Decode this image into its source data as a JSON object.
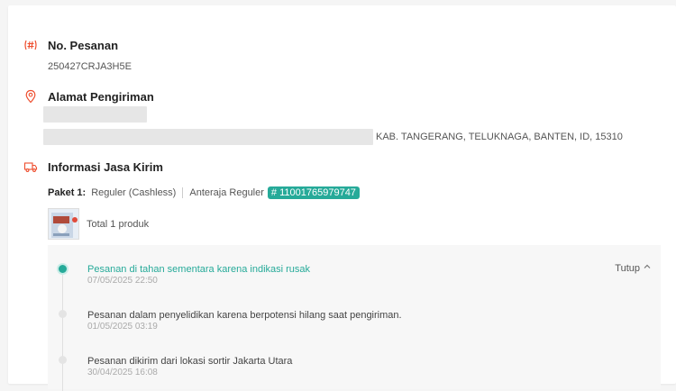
{
  "order": {
    "label": "No. Pesanan",
    "number": "250427CRJA3H5E"
  },
  "address": {
    "label": "Alamat Pengiriman",
    "region": "KAB. TANGERANG, TELUKNAGA, BANTEN, ID, 15310"
  },
  "shipping": {
    "label": "Informasi Jasa Kirim",
    "package_label": "Paket 1:",
    "service": "Reguler (Cashless)",
    "courier": "Anteraja Reguler",
    "tracking": "# 11001765979747",
    "total_products": "Total 1 produk",
    "toggle_label": "Tutup"
  },
  "tracking_events": [
    {
      "title": "Pesanan di tahan sementara karena indikasi rusak",
      "time": "07/05/2025 22:50"
    },
    {
      "title": "Pesanan dalam penyelidikan karena berpotensi hilang saat pengiriman.",
      "time": "01/05/2025 03:19"
    },
    {
      "title": "Pesanan dikirim dari lokasi sortir Jakarta Utara",
      "time": "30/04/2025 16:08"
    }
  ],
  "colors": {
    "accent_orange": "#ee4d2d",
    "accent_teal": "#26aa99"
  },
  "icons": {
    "order": "hash-icon",
    "address": "location-pin-icon",
    "shipping": "truck-icon",
    "toggle": "chevron-up-icon"
  }
}
